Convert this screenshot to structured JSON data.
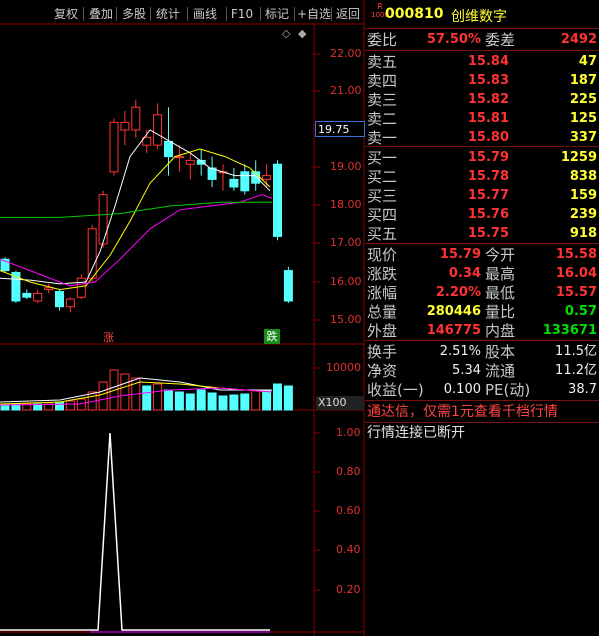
{
  "toolbar": {
    "items": [
      "复权",
      "叠加",
      "多股",
      "统计",
      "画线",
      "F10",
      "标记",
      "+自选",
      "返回"
    ]
  },
  "price_axis": {
    "ticks": [
      "22.00",
      "21.00",
      "20.00",
      "19.00",
      "18.00",
      "17.00",
      "16.00",
      "15.00"
    ],
    "current_price_tag": "19.75"
  },
  "markers": {
    "zhang": "涨",
    "die": "跌"
  },
  "volume_axis": {
    "tick": "10000",
    "unit": "X100"
  },
  "indicator_axis": {
    "ticks": [
      "1.00",
      "0.80",
      "0.60",
      "0.40",
      "0.20"
    ]
  },
  "stock": {
    "badge_top": "R",
    "badge_bottom": "1000",
    "code": "000810",
    "name": "创维数字"
  },
  "order_book": {
    "weibi_label": "委比",
    "weibi_value": "57.50%",
    "weicha_label": "委差",
    "weicha_value": "2492",
    "asks": [
      {
        "label": "卖五",
        "price": "15.84",
        "volume": "47"
      },
      {
        "label": "卖四",
        "price": "15.83",
        "volume": "187"
      },
      {
        "label": "卖三",
        "price": "15.82",
        "volume": "225"
      },
      {
        "label": "卖二",
        "price": "15.81",
        "volume": "125"
      },
      {
        "label": "卖一",
        "price": "15.80",
        "volume": "337"
      }
    ],
    "bids": [
      {
        "label": "买一",
        "price": "15.79",
        "volume": "1259"
      },
      {
        "label": "买二",
        "price": "15.78",
        "volume": "838"
      },
      {
        "label": "买三",
        "price": "15.77",
        "volume": "159"
      },
      {
        "label": "买四",
        "price": "15.76",
        "volume": "239"
      },
      {
        "label": "买五",
        "price": "15.75",
        "volume": "918"
      }
    ]
  },
  "quote": [
    {
      "l1": "现价",
      "v1": "15.79",
      "c1": "red",
      "l2": "今开",
      "v2": "15.58",
      "c2": "red"
    },
    {
      "l1": "涨跌",
      "v1": "0.34",
      "c1": "red",
      "l2": "最高",
      "v2": "16.04",
      "c2": "red"
    },
    {
      "l1": "涨幅",
      "v1": "2.20%",
      "c1": "red",
      "l2": "最低",
      "v2": "15.57",
      "c2": "red"
    },
    {
      "l1": "总量",
      "v1": "280446",
      "c1": "yellow",
      "l2": "量比",
      "v2": "0.57",
      "c2": "green"
    },
    {
      "l1": "外盘",
      "v1": "146775",
      "c1": "red",
      "l2": "内盘",
      "v2": "133671",
      "c2": "green"
    }
  ],
  "fundamentals": [
    {
      "l1": "换手",
      "v1": "2.51%",
      "l2": "股本",
      "v2": "11.5亿"
    },
    {
      "l1": "净资",
      "v1": "5.34",
      "l2": "流通",
      "v2": "11.2亿"
    },
    {
      "l1": "收益(一)",
      "v1": "0.100",
      "l2": "PE(动)",
      "v2": "38.7"
    }
  ],
  "messages": {
    "promo": "通达信，仅需1元查看千档行情",
    "status": "行情连接已断开"
  },
  "colors": {
    "up": "#ff3333",
    "down": "#54ffff",
    "grid": "#8b0000",
    "ma5": "#ffffff",
    "ma10": "#ffff00",
    "ma20": "#ff00ff",
    "ma60": "#00cc00"
  }
}
